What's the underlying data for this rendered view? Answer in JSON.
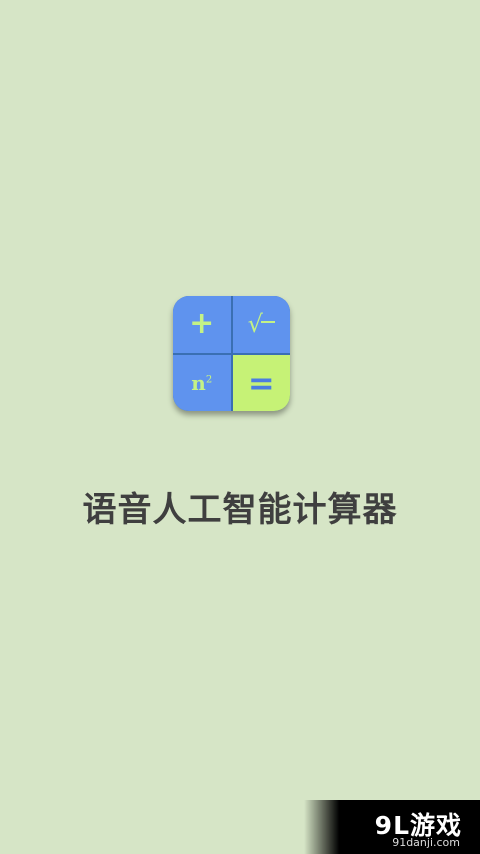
{
  "app": {
    "title": "语音人工智能计算器",
    "icon": {
      "keys": [
        "+",
        "√‾",
        "n²",
        "="
      ],
      "colors": {
        "primary": "#5f93ee",
        "accent": "#c6f276"
      }
    }
  },
  "watermark": {
    "main": "9L游戏",
    "sub": "91danji.com"
  },
  "colors": {
    "background": "#d6e5c6",
    "title": "#3f3f3f"
  }
}
